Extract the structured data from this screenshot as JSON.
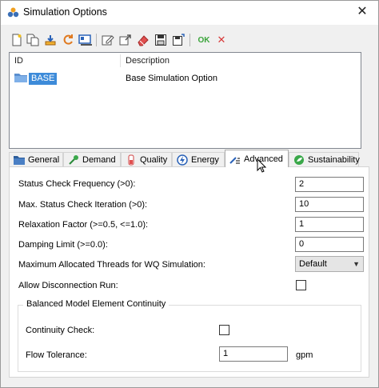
{
  "window": {
    "title": "Simulation Options",
    "close_label": "✕"
  },
  "toolbar": {
    "ok_label": "OK",
    "cancel_label": "✕"
  },
  "list": {
    "columns": [
      "ID",
      "Description"
    ],
    "rows": [
      {
        "id": "BASE",
        "description": "Base Simulation Option"
      }
    ]
  },
  "tabs": [
    {
      "label": "General",
      "icon": "folder-icon"
    },
    {
      "label": "Demand",
      "icon": "demand-icon"
    },
    {
      "label": "Quality",
      "icon": "quality-icon"
    },
    {
      "label": "Energy",
      "icon": "energy-icon"
    },
    {
      "label": "Advanced",
      "icon": "advanced-icon",
      "active": true
    },
    {
      "label": "Sustainability",
      "icon": "sustainability-icon"
    }
  ],
  "advanced": {
    "status_check_frequency": {
      "label": "Status Check Frequency (>0):",
      "value": "2"
    },
    "max_status_check_iteration": {
      "label": "Max. Status Check Iteration (>0):",
      "value": "10"
    },
    "relaxation_factor": {
      "label": "Relaxation Factor (>=0.5, <=1.0):",
      "value": "1"
    },
    "damping_limit": {
      "label": "Damping Limit (>=0.0):",
      "value": "0"
    },
    "max_threads": {
      "label": "Maximum Allocated Threads for WQ Simulation:",
      "value": "Default"
    },
    "allow_disconnection": {
      "label": "Allow Disconnection Run:",
      "checked": false
    },
    "continuity_group": {
      "title": "Balanced Model Element Continuity",
      "continuity_check": {
        "label": "Continuity Check:",
        "checked": false
      },
      "flow_tolerance": {
        "label": "Flow Tolerance:",
        "value": "1",
        "unit": "gpm"
      }
    }
  },
  "colors": {
    "selection": "#3d8bd9",
    "ok": "#3aa43a",
    "cancel": "#d83a3a"
  }
}
